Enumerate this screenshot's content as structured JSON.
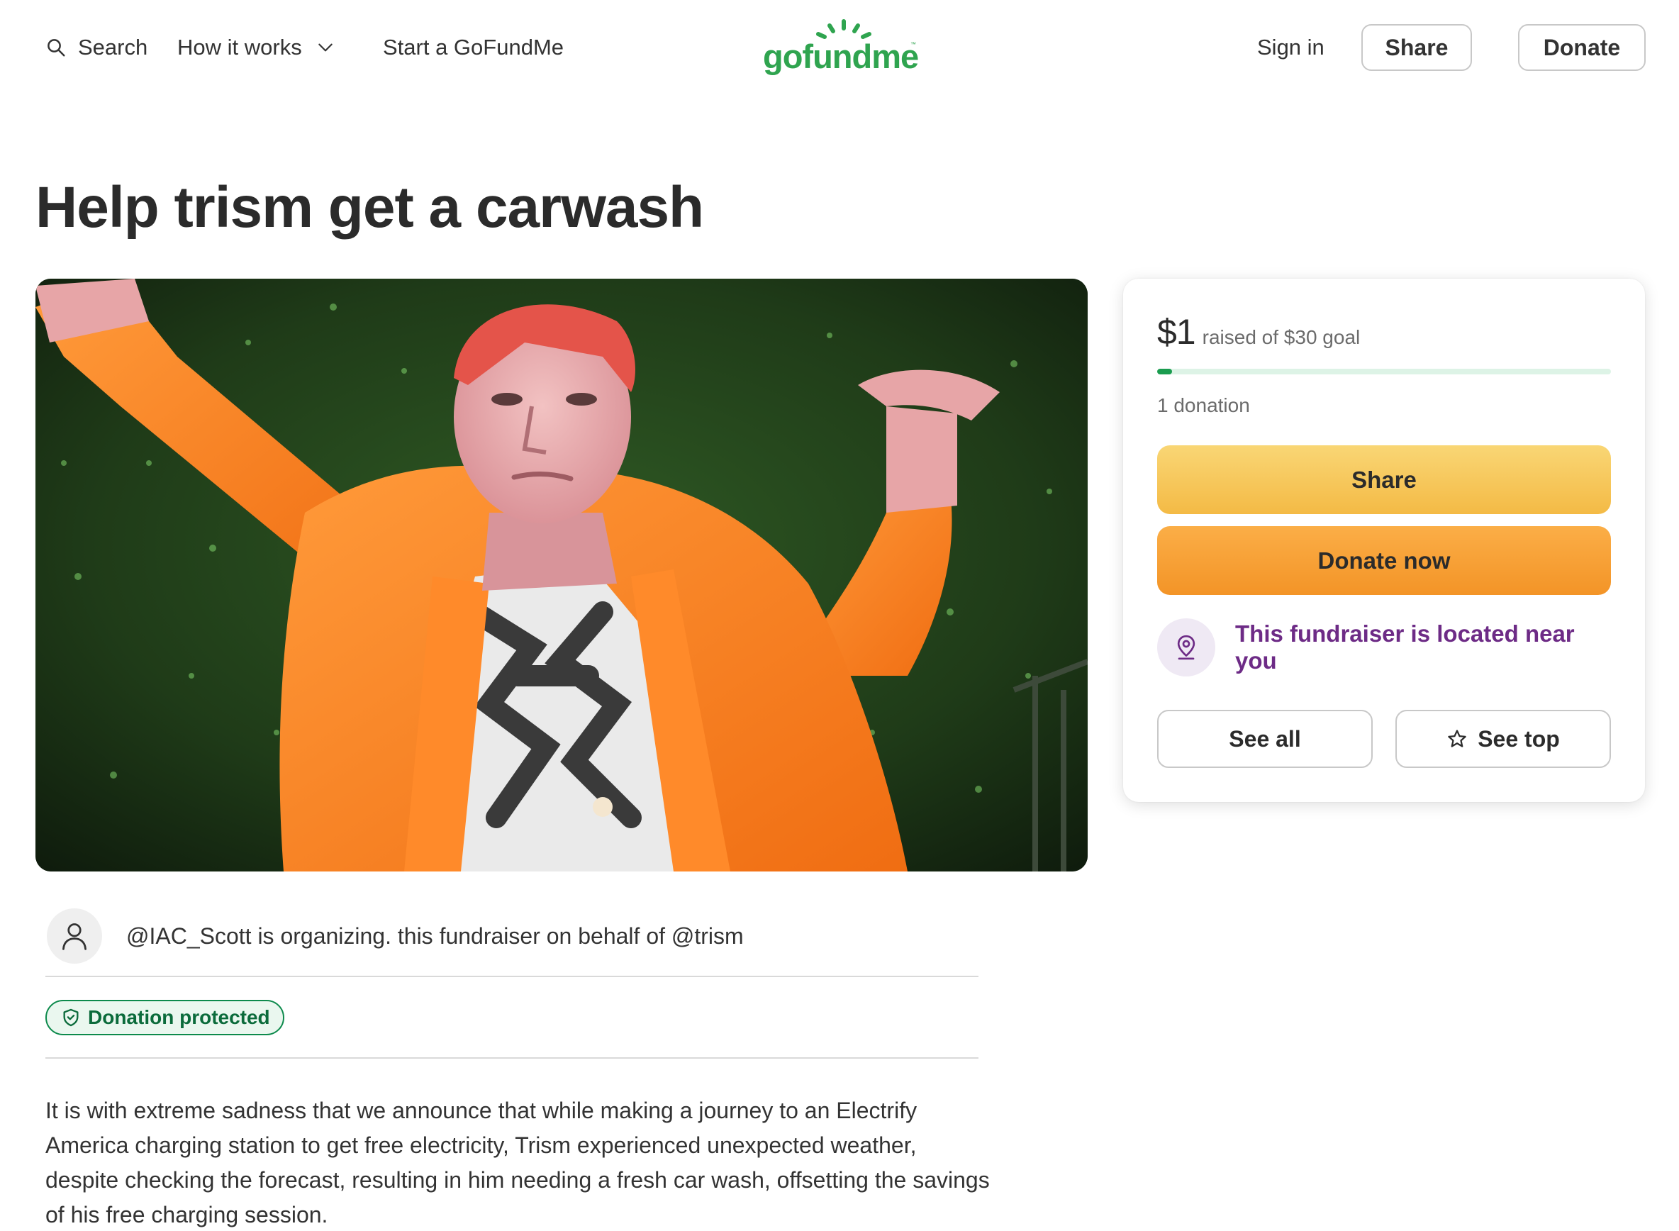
{
  "nav": {
    "search_label": "Search",
    "how_label": "How it works",
    "start_label": "Start a GoFundMe",
    "logo_text": "gofundme",
    "logo_tm": "™",
    "signin_label": "Sign in",
    "share_label": "Share",
    "donate_label": "Donate"
  },
  "page": {
    "title": "Help trism get a carwash"
  },
  "organizer": {
    "text": "@IAC_Scott is organizing. this fundraiser on behalf of @trism"
  },
  "badge": {
    "label": "Donation protected"
  },
  "story": {
    "text": "It is with extreme sadness that we announce that while making a journey to an Electrify America charging station to get free electricity, Trism experienced unexpected weather, despite checking the forecast, resulting in him needing a fresh car wash, offsetting the savings of his free charging session."
  },
  "card": {
    "amount": "$1",
    "goal_text": "raised of $30 goal",
    "progress_fraction": 0.033,
    "donation_count": "1 donation",
    "share_label": "Share",
    "donate_label": "Donate now",
    "nearby_text": "This fundraiser is located near you",
    "see_all_label": "See all",
    "see_top_label": "See top"
  },
  "colors": {
    "brand_green": "#2fa44f",
    "progress_green": "#1a9c4f",
    "share_yellow": "#f4ba45",
    "donate_orange": "#f39427",
    "nearby_purple": "#6d2b86"
  },
  "icons": {
    "search": "search-icon",
    "chevron": "chevron-down-icon",
    "user": "user-icon",
    "shield": "shield-icon",
    "location": "location-pin-icon",
    "star": "star-icon"
  }
}
